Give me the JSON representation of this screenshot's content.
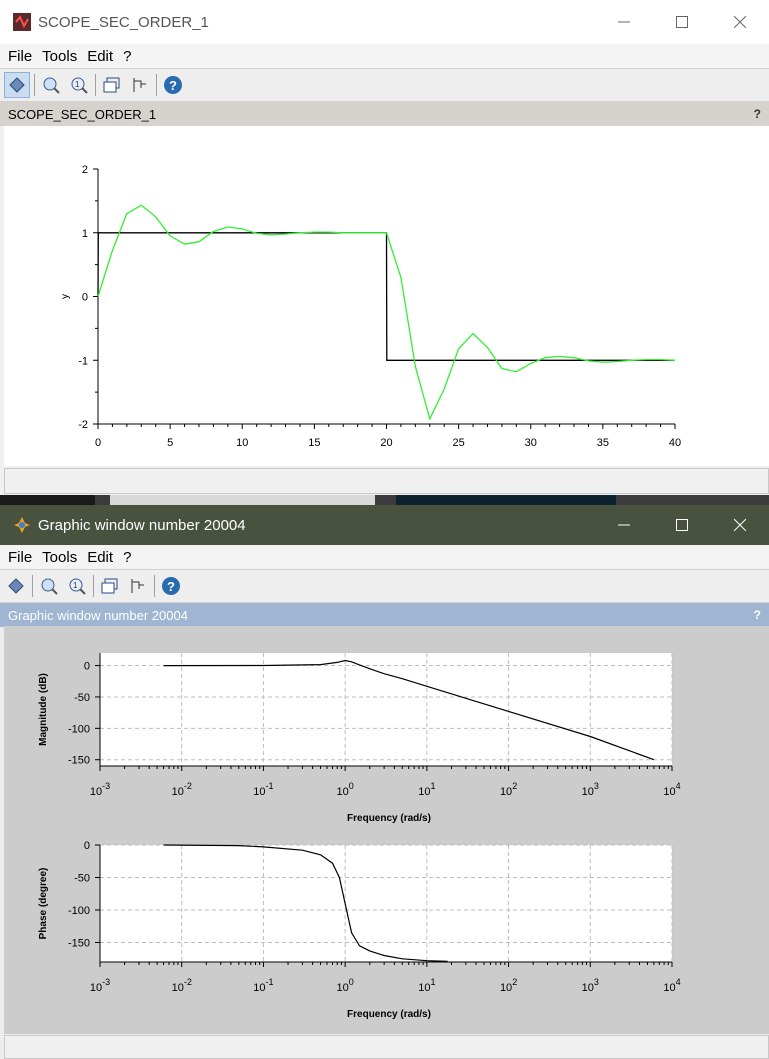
{
  "scope_window": {
    "title": "SCOPE_SEC_ORDER_1",
    "menu": [
      "File",
      "Tools",
      "Edit",
      "?"
    ],
    "doc_title": "SCOPE_SEC_ORDER_1",
    "help": "?"
  },
  "graphic_window": {
    "title": "Graphic window number 20004",
    "menu": [
      "File",
      "Tools",
      "Edit",
      "?"
    ],
    "doc_title": "Graphic window number 20004",
    "help": "?"
  },
  "toolbar_icons": [
    "rotate-icon",
    "zoom-in-icon",
    "zoom-reset-icon",
    "window-icon",
    "datatip-icon",
    "help-icon"
  ],
  "chart_data": [
    {
      "type": "line",
      "xlim": [
        0,
        40
      ],
      "ylim": [
        -2,
        2
      ],
      "xticks": [
        "0",
        "5",
        "10",
        "15",
        "20",
        "25",
        "30",
        "35",
        "40"
      ],
      "yticks": [
        "-2",
        "-1",
        "0",
        "1",
        "2"
      ],
      "ylabel": "y",
      "series": [
        {
          "color": "#000000",
          "x": [
            0,
            0.02,
            20,
            20.02,
            40
          ],
          "y": [
            0,
            1,
            1,
            -1,
            -1
          ]
        },
        {
          "color": "#33ee33",
          "x": [
            0,
            1,
            2,
            3,
            4,
            5,
            6,
            7,
            8,
            9,
            10,
            11,
            12,
            13,
            14,
            15,
            16,
            17,
            18,
            19,
            20,
            21,
            22,
            23,
            24,
            25,
            26,
            27,
            28,
            29,
            30,
            31,
            32,
            33,
            34,
            35,
            36,
            37,
            38,
            39,
            40
          ],
          "y": [
            0,
            0.72,
            1.3,
            1.43,
            1.25,
            0.95,
            0.82,
            0.86,
            1.02,
            1.09,
            1.06,
            0.99,
            0.97,
            0.98,
            1.0,
            1.01,
            1.01,
            1.0,
            1.0,
            1.0,
            1.0,
            0.3,
            -1.1,
            -1.92,
            -1.45,
            -0.82,
            -0.58,
            -0.8,
            -1.13,
            -1.18,
            -1.05,
            -0.96,
            -0.94,
            -0.96,
            -1.01,
            -1.03,
            -1.02,
            -1.0,
            -0.99,
            -0.99,
            -1.0
          ]
        }
      ]
    },
    {
      "type": "line",
      "x_scale": "log",
      "xlim": [
        0.001,
        10000
      ],
      "ylim": [
        -160,
        20
      ],
      "xlabel": "Frequency (rad/s)",
      "ylabel": "Magnitude (dB)",
      "yticks": [
        "0",
        "-50",
        "-100",
        "-150"
      ],
      "xticks": [
        "10^-3",
        "10^-2",
        "10^-1",
        "10^0",
        "10^1",
        "10^2",
        "10^3",
        "10^4"
      ],
      "grid": true,
      "series": [
        {
          "color": "#000000",
          "x": [
            0.006,
            0.1,
            0.5,
            0.8,
            1.0,
            1.2,
            1.5,
            2,
            3,
            5,
            10,
            100,
            1000,
            6000
          ],
          "y": [
            0,
            0.1,
            1.5,
            5,
            8,
            6,
            1,
            -5,
            -13,
            -21,
            -33,
            -73,
            -113,
            -150
          ]
        }
      ]
    },
    {
      "type": "line",
      "x_scale": "log",
      "xlim": [
        0.001,
        10000
      ],
      "ylim": [
        -180,
        0
      ],
      "xlabel": "Frequency (rad/s)",
      "ylabel": "Phase (degree)",
      "yticks": [
        "0",
        "-50",
        "-100",
        "-150"
      ],
      "xticks": [
        "10^-3",
        "10^-2",
        "10^-1",
        "10^0",
        "10^1",
        "10^2",
        "10^3",
        "10^4"
      ],
      "grid": true,
      "series": [
        {
          "color": "#000000",
          "x": [
            0.006,
            0.05,
            0.1,
            0.3,
            0.5,
            0.7,
            0.85,
            1.0,
            1.2,
            1.5,
            2,
            3,
            5,
            10,
            18
          ],
          "y": [
            0,
            -1,
            -3,
            -8,
            -15,
            -28,
            -50,
            -90,
            -135,
            -155,
            -163,
            -170,
            -175,
            -178,
            -179
          ]
        }
      ]
    }
  ]
}
